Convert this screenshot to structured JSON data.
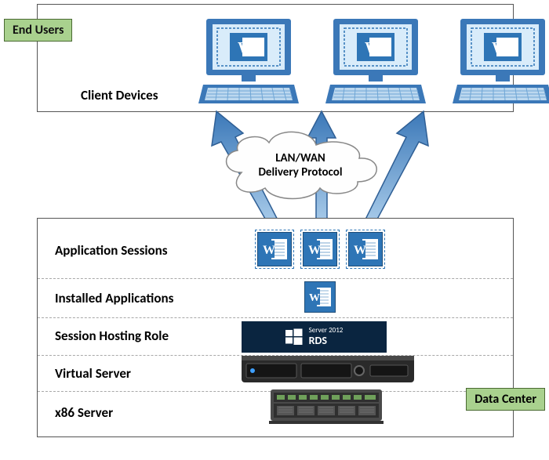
{
  "labels": {
    "end_users": "End Users",
    "client_devices": "Client Devices",
    "cloud_line1": "LAN/WAN",
    "cloud_line2": "Delivery Protocol",
    "data_center": "Data Center"
  },
  "layers": {
    "app_sessions": "Application Sessions",
    "installed_apps": "Installed Applications",
    "session_hosting": "Session Hosting Role",
    "virtual_server": "Virtual Server",
    "x86_server": "x86 Server"
  },
  "rds": {
    "product": "Server 2012",
    "role": "RDS"
  },
  "icons": {
    "word": "W",
    "windows": "⊞"
  },
  "colors": {
    "blue": "#2e75b6",
    "blue_dark": "#1f4e79",
    "green": "#a9d18e",
    "navy": "#0a2540",
    "arrow": "#4a90d9"
  }
}
